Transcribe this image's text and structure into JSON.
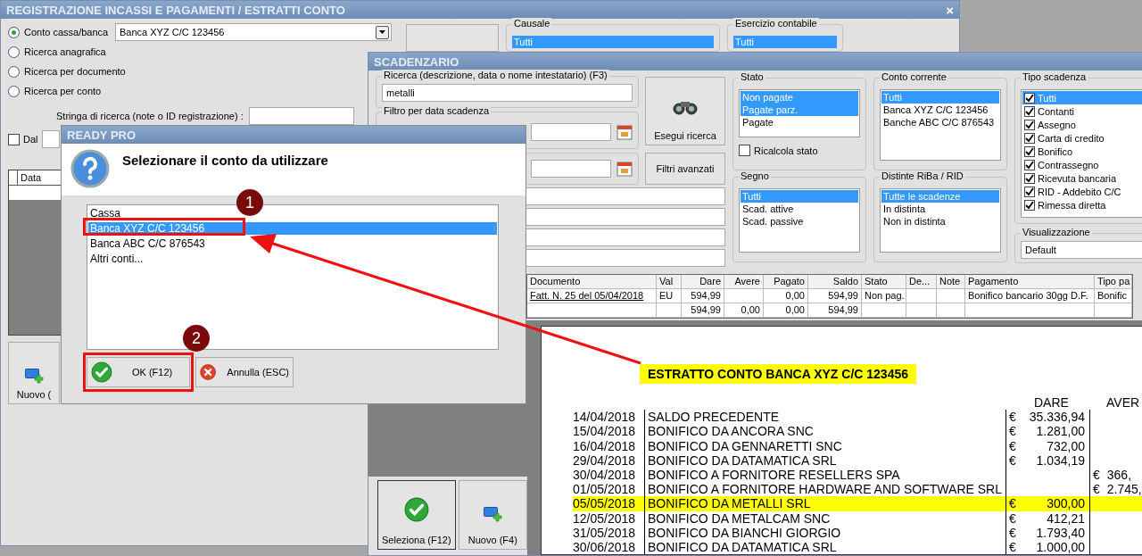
{
  "main_window": {
    "title": "REGISTRAZIONE INCASSI E PAGAMENTI / ESTRATTI CONTO",
    "close": "×",
    "search_modes": [
      {
        "label": "Conto cassa/banca",
        "selected": true
      },
      {
        "label": "Ricerca anagrafica",
        "selected": false
      },
      {
        "label": "Ricerca per documento",
        "selected": false
      },
      {
        "label": "Ricerca per conto",
        "selected": false
      }
    ],
    "account_select": {
      "value": "Banca XYZ C/C 123456"
    },
    "search_string": {
      "label": "Stringa di ricerca (note o ID registrazione) :"
    },
    "date_from": {
      "label": "Dal",
      "checked": false
    },
    "grid": {
      "columns": [
        "Data"
      ]
    },
    "buttons": [
      "Nuovo ("
    ],
    "causale": {
      "title": "Causale",
      "items": [
        {
          "label": "Tutti",
          "selected": true
        }
      ]
    },
    "esercizio": {
      "title": "Esercizio contabile",
      "items": [
        {
          "label": "Tutti",
          "selected": true
        }
      ]
    }
  },
  "scadenzario": {
    "title": "SCADENZARIO",
    "search": {
      "title": "Ricerca (descrizione, data o nome intestatario) (F3)",
      "value": "metalli"
    },
    "date_filter": {
      "title": "Filtro per data scadenza"
    },
    "buttons": [
      {
        "label": "Esegui ricerca",
        "kind": "search"
      },
      {
        "label": "Filtri avanzati",
        "kind": "plain"
      }
    ],
    "stato": {
      "title": "Stato",
      "items": [
        {
          "label": "Non pagate",
          "selected": true
        },
        {
          "label": "Pagate parz.",
          "selected": true
        },
        {
          "label": "Pagate",
          "selected": false
        }
      ],
      "recalc": {
        "label": "Ricalcola stato",
        "checked": false
      }
    },
    "conto_corrente": {
      "title": "Conto corrente",
      "items": [
        {
          "label": "Tutti",
          "selected": true
        },
        {
          "label": "Banca XYZ C/C 123456",
          "selected": false
        },
        {
          "label": "Banche ABC C/C 876543",
          "selected": false
        }
      ]
    },
    "segno": {
      "title": "Segno",
      "items": [
        {
          "label": "Tutti",
          "selected": true
        },
        {
          "label": "Scad. attive",
          "selected": false
        },
        {
          "label": "Scad. passive",
          "selected": false
        }
      ]
    },
    "distinte": {
      "title": "Distinte RiBa / RID",
      "items": [
        {
          "label": "Tutte le scadenze",
          "selected": true
        },
        {
          "label": "In distinta",
          "selected": false
        },
        {
          "label": "Non in distinta",
          "selected": false
        }
      ]
    },
    "tipo_scadenza": {
      "title": "Tipo scadenza",
      "items": [
        {
          "label": "Tutti",
          "checked": true,
          "selected": true
        },
        {
          "label": "Contanti",
          "checked": true,
          "selected": false
        },
        {
          "label": "Assegno",
          "checked": true,
          "selected": false
        },
        {
          "label": "Carta di credito",
          "checked": true,
          "selected": false
        },
        {
          "label": "Bonifico",
          "checked": true,
          "selected": false
        },
        {
          "label": "Contrassegno",
          "checked": true,
          "selected": false
        },
        {
          "label": "Ricevuta bancaria",
          "checked": true,
          "selected": false
        },
        {
          "label": "RID - Addebito C/C",
          "checked": true,
          "selected": false
        },
        {
          "label": "Rimessa diretta",
          "checked": true,
          "selected": false
        }
      ]
    },
    "visualizzazione": {
      "title": "Visualizzazione",
      "value": "Default"
    },
    "table": {
      "columns": [
        "Documento",
        "Val",
        "Dare",
        "Avere",
        "Pagato",
        "Saldo",
        "Stato",
        "De...",
        "Note",
        "Pagamento",
        "Tipo pa"
      ],
      "rows": [
        {
          "document_link": true,
          "cells": [
            "Fatt. N. 25 del 05/04/2018",
            "EU",
            "594,99",
            "",
            "0,00",
            "594,99",
            "Non pag.",
            "",
            "",
            "Bonifico bancario 30gg D.F.",
            "Bonific"
          ]
        },
        {
          "cells": [
            "",
            "",
            "594,99",
            "0,00",
            "0,00",
            "594,99",
            "",
            "",
            "",
            "",
            ""
          ]
        }
      ]
    },
    "bottom_buttons": [
      {
        "label": "Seleziona (F12)",
        "kind": "confirm"
      },
      {
        "label": "Nuovo (F4)",
        "kind": "new"
      }
    ],
    "statement": {
      "title": "ESTRATTO CONTO BANCA XYZ C/C 123456",
      "dare_heading": "DARE",
      "avere_heading": "AVER",
      "rows": [
        {
          "date": "14/04/2018",
          "description": "SALDO PRECEDENTE",
          "dare": {
            "symbol": "€",
            "amount": "35.336,94"
          },
          "highlighted": false
        },
        {
          "date": "15/04/2018",
          "description": "BONIFICO DA ANCORA SNC",
          "dare": {
            "symbol": "€",
            "amount": "1.281,00"
          },
          "highlighted": false
        },
        {
          "date": "16/04/2018",
          "description": "BONIFICO DA GENNARETTI SNC",
          "dare": {
            "symbol": "€",
            "amount": "732,00"
          },
          "highlighted": false
        },
        {
          "date": "29/04/2018",
          "description": "BONIFICO DA DATAMATICA SRL",
          "dare": {
            "symbol": "€",
            "amount": "1.034,19"
          },
          "highlighted": false
        },
        {
          "date": "30/04/2018",
          "description": "BONIFICO A FORNITORE RESELLERS SPA",
          "avere": {
            "symbol": "€",
            "amount": "366,"
          },
          "highlighted": false
        },
        {
          "date": "01/05/2018",
          "description": "BONIFICO A FORNITORE HARDWARE AND SOFTWARE SRL",
          "avere": {
            "symbol": "€",
            "amount": "2.745,"
          },
          "highlighted": false
        },
        {
          "date": "05/05/2018",
          "description": "BONIFICO DA METALLI SRL",
          "dare": {
            "symbol": "€",
            "amount": "300,00"
          },
          "highlighted": true
        },
        {
          "date": "12/05/2018",
          "description": "BONIFICO DA METALCAM SNC",
          "dare": {
            "symbol": "€",
            "amount": "412,21"
          },
          "highlighted": false
        },
        {
          "date": "31/05/2018",
          "description": "BONIFICO DA BIANCHI GIORGIO",
          "dare": {
            "symbol": "€",
            "amount": "1.793,40"
          },
          "highlighted": false
        },
        {
          "date": "30/06/2018",
          "description": "BONIFICO DA DATAMATICA SRL",
          "dare": {
            "symbol": "€",
            "amount": "1.000,00"
          },
          "highlighted": false
        }
      ]
    }
  },
  "dialog": {
    "title": "READY PRO",
    "message": "Selezionare il conto da utilizzare",
    "items": [
      {
        "label": "Cassa",
        "selected": false
      },
      {
        "label": "Banca XYZ C/C 123456",
        "selected": true
      },
      {
        "label": "Banca ABC C/C 876543",
        "selected": false
      },
      {
        "label": "Altri conti...",
        "selected": false
      }
    ],
    "buttons": [
      {
        "label": "OK (F12)",
        "kind": "ok"
      },
      {
        "label": "Annulla (ESC)",
        "kind": "cancel"
      }
    ]
  },
  "annotations": [
    {
      "label": "1"
    },
    {
      "label": "2"
    }
  ]
}
